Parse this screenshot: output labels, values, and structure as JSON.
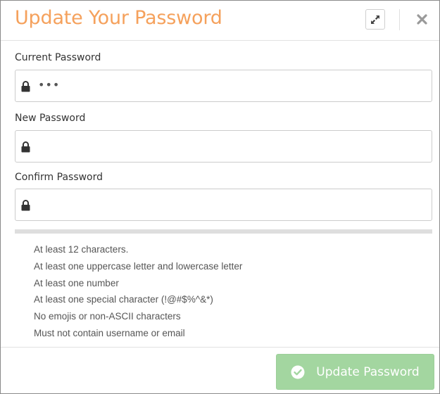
{
  "dialog": {
    "title": "Update Your Password",
    "expand_icon": "expand-arrows-icon",
    "close_icon": "close-icon"
  },
  "fields": {
    "current": {
      "label": "Current Password",
      "value_masked": "•••",
      "icon": "lock-icon"
    },
    "new": {
      "label": "New Password",
      "value_masked": "",
      "icon": "lock-icon"
    },
    "confirm": {
      "label": "Confirm Password",
      "value_masked": "",
      "icon": "lock-icon"
    }
  },
  "strength": {
    "level": 0
  },
  "requirements": [
    "At least 12 characters.",
    "At least one uppercase letter and lowercase letter",
    "At least one number",
    "At least one special character (!@#$%^&*)",
    "No emojis or non-ASCII characters",
    "Must not contain username or email"
  ],
  "footer": {
    "submit_label": "Update Password",
    "submit_icon": "check-circle-icon",
    "submit_enabled": false
  },
  "colors": {
    "title": "#f5a15c",
    "submit_bg": "#a3d6a0",
    "strength_track": "#dedede"
  }
}
